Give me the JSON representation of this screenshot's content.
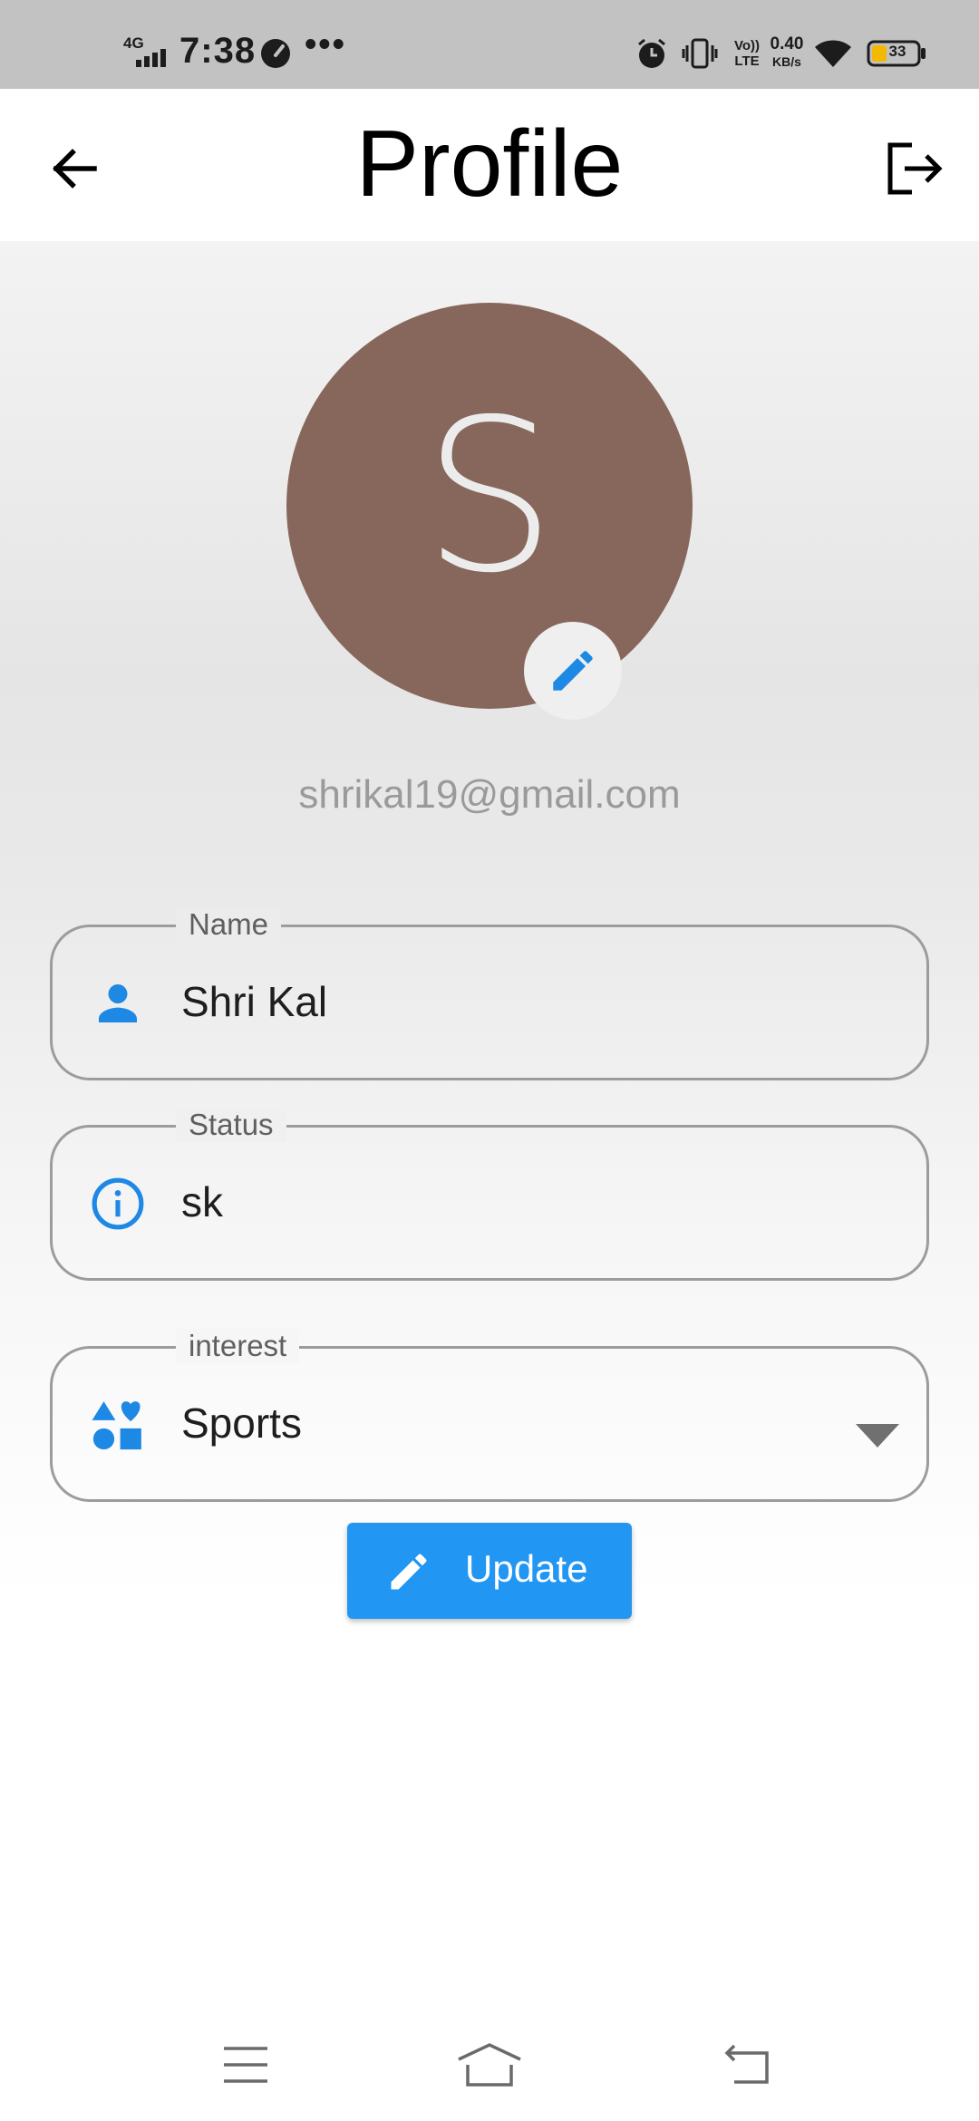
{
  "status_bar": {
    "network": "4G",
    "time": "7:38",
    "more": "•••",
    "volte_top": "Vo))",
    "volte_bottom": "LTE",
    "speed_value": "0.40",
    "speed_unit": "KB/s",
    "battery": "33",
    "icons": [
      "signal-icon",
      "speed-gauge-icon",
      "alarm-icon",
      "vibrate-icon",
      "wifi-icon",
      "battery-icon"
    ]
  },
  "app_bar": {
    "title": "Profile",
    "back_icon": "arrow-left-icon",
    "logout_icon": "logout-icon"
  },
  "profile": {
    "avatar_letter": "S",
    "avatar_color": "#87675b",
    "email": "shrikal19@gmail.com",
    "edit_icon": "pencil-icon"
  },
  "fields": {
    "name": {
      "label": "Name",
      "value": "Shri Kal",
      "icon": "person-icon"
    },
    "status": {
      "label": "Status",
      "value": "sk",
      "icon": "info-icon"
    },
    "interest": {
      "label": "interest",
      "value": "Sports",
      "icon": "category-icon"
    }
  },
  "update_button": {
    "label": "Update",
    "icon": "pencil-icon"
  },
  "accent_color": "#2196f3",
  "nav_bar": {
    "icons": [
      "menu-icon",
      "home-icon",
      "back-icon"
    ]
  }
}
